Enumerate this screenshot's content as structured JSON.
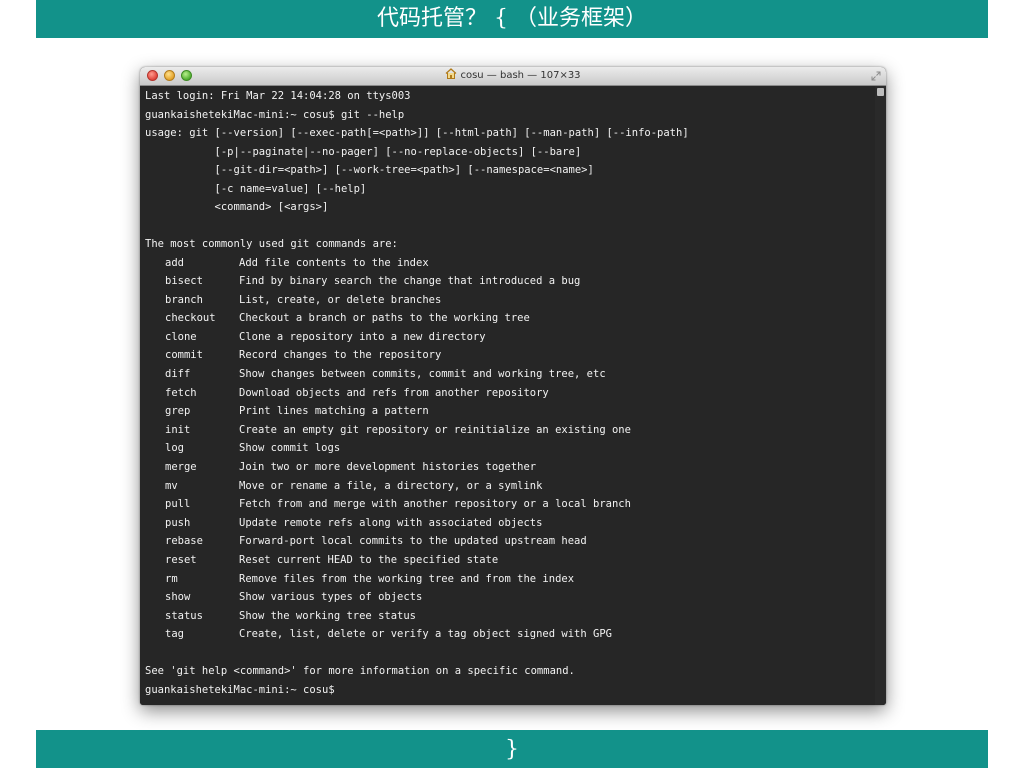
{
  "slide": {
    "title": "代码托管？ { （业务框架）",
    "footer": "}",
    "accent_color": "#12928a"
  },
  "window": {
    "title": "cosu — bash — 107×33",
    "title_icon": "home-icon"
  },
  "terminal": {
    "lines_before": [
      "Last login: Fri Mar 22 14:04:28 on ttys003",
      "guankaishetekiMac-mini:~ cosu$ git --help",
      "usage: git [--version] [--exec-path[=<path>]] [--html-path] [--man-path] [--info-path]",
      "           [-p|--paginate|--no-pager] [--no-replace-objects] [--bare]",
      "           [--git-dir=<path>] [--work-tree=<path>] [--namespace=<name>]",
      "           [-c name=value] [--help]",
      "           <command> [<args>]",
      "",
      "The most commonly used git commands are:"
    ],
    "commands": [
      {
        "name": "add",
        "desc": "Add file contents to the index"
      },
      {
        "name": "bisect",
        "desc": "Find by binary search the change that introduced a bug"
      },
      {
        "name": "branch",
        "desc": "List, create, or delete branches"
      },
      {
        "name": "checkout",
        "desc": "Checkout a branch or paths to the working tree"
      },
      {
        "name": "clone",
        "desc": "Clone a repository into a new directory"
      },
      {
        "name": "commit",
        "desc": "Record changes to the repository"
      },
      {
        "name": "diff",
        "desc": "Show changes between commits, commit and working tree, etc"
      },
      {
        "name": "fetch",
        "desc": "Download objects and refs from another repository"
      },
      {
        "name": "grep",
        "desc": "Print lines matching a pattern"
      },
      {
        "name": "init",
        "desc": "Create an empty git repository or reinitialize an existing one"
      },
      {
        "name": "log",
        "desc": "Show commit logs"
      },
      {
        "name": "merge",
        "desc": "Join two or more development histories together"
      },
      {
        "name": "mv",
        "desc": "Move or rename a file, a directory, or a symlink"
      },
      {
        "name": "pull",
        "desc": "Fetch from and merge with another repository or a local branch"
      },
      {
        "name": "push",
        "desc": "Update remote refs along with associated objects"
      },
      {
        "name": "rebase",
        "desc": "Forward-port local commits to the updated upstream head"
      },
      {
        "name": "reset",
        "desc": "Reset current HEAD to the specified state"
      },
      {
        "name": "rm",
        "desc": "Remove files from the working tree and from the index"
      },
      {
        "name": "show",
        "desc": "Show various types of objects"
      },
      {
        "name": "status",
        "desc": "Show the working tree status"
      },
      {
        "name": "tag",
        "desc": "Create, list, delete or verify a tag object signed with GPG"
      }
    ],
    "lines_after": [
      "",
      "See 'git help <command>' for more information on a specific command.",
      "guankaishetekiMac-mini:~ cosu$"
    ]
  }
}
